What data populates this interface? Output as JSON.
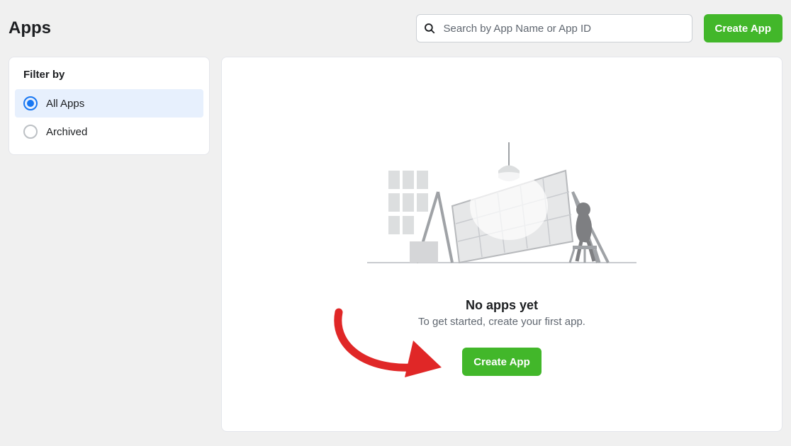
{
  "header": {
    "title": "Apps",
    "search_placeholder": "Search by App Name or App ID",
    "create_button": "Create App"
  },
  "sidebar": {
    "filter_title": "Filter by",
    "items": [
      {
        "label": "All Apps",
        "selected": true
      },
      {
        "label": "Archived",
        "selected": false
      }
    ]
  },
  "main": {
    "empty_title": "No apps yet",
    "empty_subtitle": "To get started, create your first app.",
    "create_button": "Create App"
  },
  "colors": {
    "accent_green": "#42b72a",
    "accent_blue": "#1877f2",
    "annotation_red": "#e02727"
  }
}
